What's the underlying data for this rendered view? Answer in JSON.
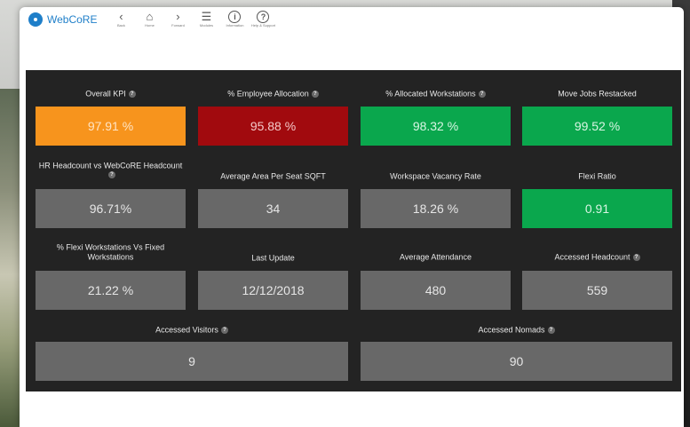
{
  "app": {
    "name": "WebCoRE",
    "nav": [
      {
        "icon": "back-icon",
        "glyph": "‹",
        "label": "Back"
      },
      {
        "icon": "home-icon",
        "glyph": "⌂",
        "label": "Home"
      },
      {
        "icon": "forward-icon",
        "glyph": "›",
        "label": "Forward"
      },
      {
        "icon": "modules-icon",
        "glyph": "☰",
        "label": "Modules"
      },
      {
        "icon": "information-icon",
        "glyph": "i",
        "label": "Information"
      },
      {
        "icon": "help-support-icon",
        "glyph": "?",
        "label": "Help & Support"
      }
    ]
  },
  "kpis": [
    {
      "label": "Overall KPI",
      "info": true,
      "value": "97.91 %",
      "color": "#f7941d"
    },
    {
      "label": "% Employee Allocation",
      "info": true,
      "value": "95.88 %",
      "color": "#a10a0e"
    },
    {
      "label": "% Allocated Workstations",
      "info": true,
      "value": "98.32 %",
      "color": "#0aa74d"
    },
    {
      "label": "Move Jobs Restacked",
      "info": false,
      "value": "99.52 %",
      "color": "#0aa74d"
    },
    {
      "label": "HR Headcount vs WebCoRE Headcount",
      "info": true,
      "value": "96.71%",
      "color": "#686868"
    },
    {
      "label": "Average Area Per Seat SQFT",
      "info": false,
      "value": "34",
      "color": "#686868"
    },
    {
      "label": "Workspace Vacancy Rate",
      "info": false,
      "value": "18.26 %",
      "color": "#686868"
    },
    {
      "label": "Flexi Ratio",
      "info": false,
      "value": "0.91",
      "color": "#0aa74d"
    },
    {
      "label": "% Flexi Workstations Vs Fixed Workstations",
      "info": false,
      "value": "21.22 %",
      "color": "#686868"
    },
    {
      "label": "Last Update",
      "info": false,
      "value": "12/12/2018",
      "color": "#686868"
    },
    {
      "label": "Average Attendance",
      "info": false,
      "value": "480",
      "color": "#686868"
    },
    {
      "label": "Accessed Headcount",
      "info": true,
      "value": "559",
      "color": "#686868"
    },
    {
      "label": "Accessed Visitors",
      "info": true,
      "value": "9",
      "color": "#686868"
    },
    {
      "label": "Accessed Nomads",
      "info": true,
      "value": "90",
      "color": "#686868"
    }
  ],
  "info_glyph": "?"
}
